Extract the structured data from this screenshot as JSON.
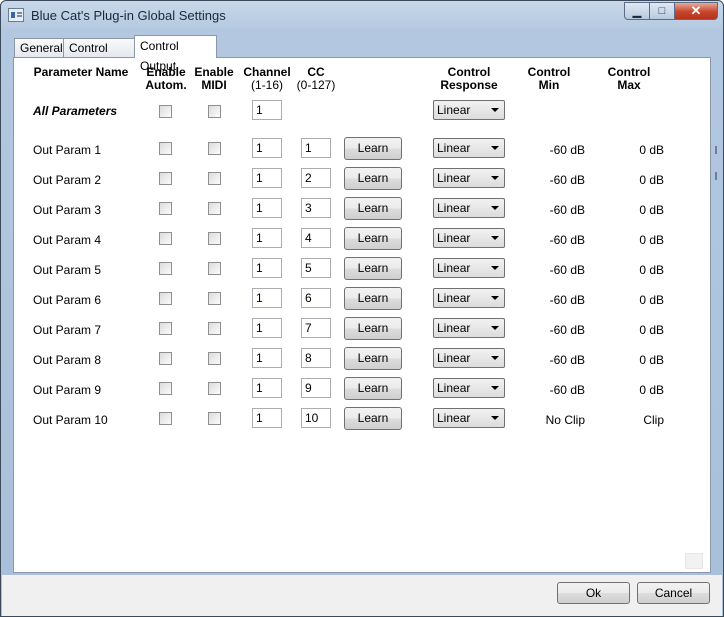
{
  "window": {
    "title": "Blue Cat's Plug-in Global Settings"
  },
  "titlebar_buttons": {
    "minimize": "▁",
    "maximize": "□",
    "close": "✕"
  },
  "tabs": [
    {
      "label": "General"
    },
    {
      "label": "Control Input"
    },
    {
      "label": "Control Output"
    }
  ],
  "headers": {
    "param_name": "Parameter Name",
    "enable_autom": [
      "Enable",
      "Autom."
    ],
    "enable_midi": [
      "Enable",
      "MIDI"
    ],
    "channel": [
      "Channel",
      "(1-16)"
    ],
    "cc": [
      "CC",
      "(0-127)"
    ],
    "control_response": [
      "Control",
      "Response"
    ],
    "control_min": [
      "Control",
      "Min"
    ],
    "control_max": [
      "Control",
      "Max"
    ]
  },
  "all_parameters": {
    "label": "All Parameters",
    "channel": "1",
    "response": "Linear"
  },
  "learn_label": "Learn",
  "params": [
    {
      "name": "Out Param 1",
      "channel": "1",
      "cc": "1",
      "response": "Linear",
      "min": "-60 dB",
      "max": "0 dB"
    },
    {
      "name": "Out Param 2",
      "channel": "1",
      "cc": "2",
      "response": "Linear",
      "min": "-60 dB",
      "max": "0 dB"
    },
    {
      "name": "Out Param 3",
      "channel": "1",
      "cc": "3",
      "response": "Linear",
      "min": "-60 dB",
      "max": "0 dB"
    },
    {
      "name": "Out Param 4",
      "channel": "1",
      "cc": "4",
      "response": "Linear",
      "min": "-60 dB",
      "max": "0 dB"
    },
    {
      "name": "Out Param 5",
      "channel": "1",
      "cc": "5",
      "response": "Linear",
      "min": "-60 dB",
      "max": "0 dB"
    },
    {
      "name": "Out Param 6",
      "channel": "1",
      "cc": "6",
      "response": "Linear",
      "min": "-60 dB",
      "max": "0 dB"
    },
    {
      "name": "Out Param 7",
      "channel": "1",
      "cc": "7",
      "response": "Linear",
      "min": "-60 dB",
      "max": "0 dB"
    },
    {
      "name": "Out Param 8",
      "channel": "1",
      "cc": "8",
      "response": "Linear",
      "min": "-60 dB",
      "max": "0 dB"
    },
    {
      "name": "Out Param 9",
      "channel": "1",
      "cc": "9",
      "response": "Linear",
      "min": "-60 dB",
      "max": "0 dB"
    },
    {
      "name": "Out Param 10",
      "channel": "1",
      "cc": "10",
      "response": "Linear",
      "min": "No Clip",
      "max": "Clip"
    }
  ],
  "footer": {
    "ok": "Ok",
    "cancel": "Cancel"
  }
}
